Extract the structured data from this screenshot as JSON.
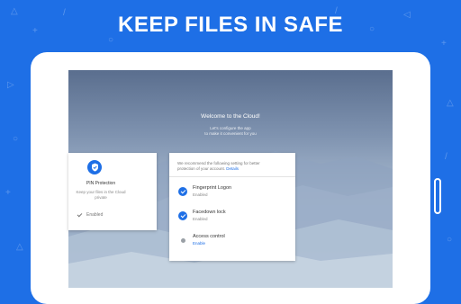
{
  "banner": {
    "headline": "KEEP FILES IN SAFE"
  },
  "colors": {
    "brand": "#1e6fe6",
    "white": "#ffffff",
    "accent_link": "#1e6fe6"
  },
  "screen": {
    "welcome_title": "Welcome to the Cloud!",
    "welcome_line1": "Let's configure the app",
    "welcome_line2": "to make it convenient for you"
  },
  "pin_card": {
    "icon": "shield-check-icon",
    "title": "PIN Protection",
    "desc_line1": "Keep your files in the Cloud",
    "desc_line2": "private",
    "status": "Enabled"
  },
  "settings_card": {
    "recommend_line1": "We recommend the following setting for better",
    "recommend_line2": "protection of your account.",
    "details_link": "Details",
    "options": [
      {
        "title": "Fingerprint Logon",
        "status": "Enabled",
        "enabled": true
      },
      {
        "title": "Facedown lock",
        "status": "Enabled",
        "enabled": true
      },
      {
        "title": "Access control",
        "status": "Enable",
        "enabled": false
      }
    ]
  }
}
